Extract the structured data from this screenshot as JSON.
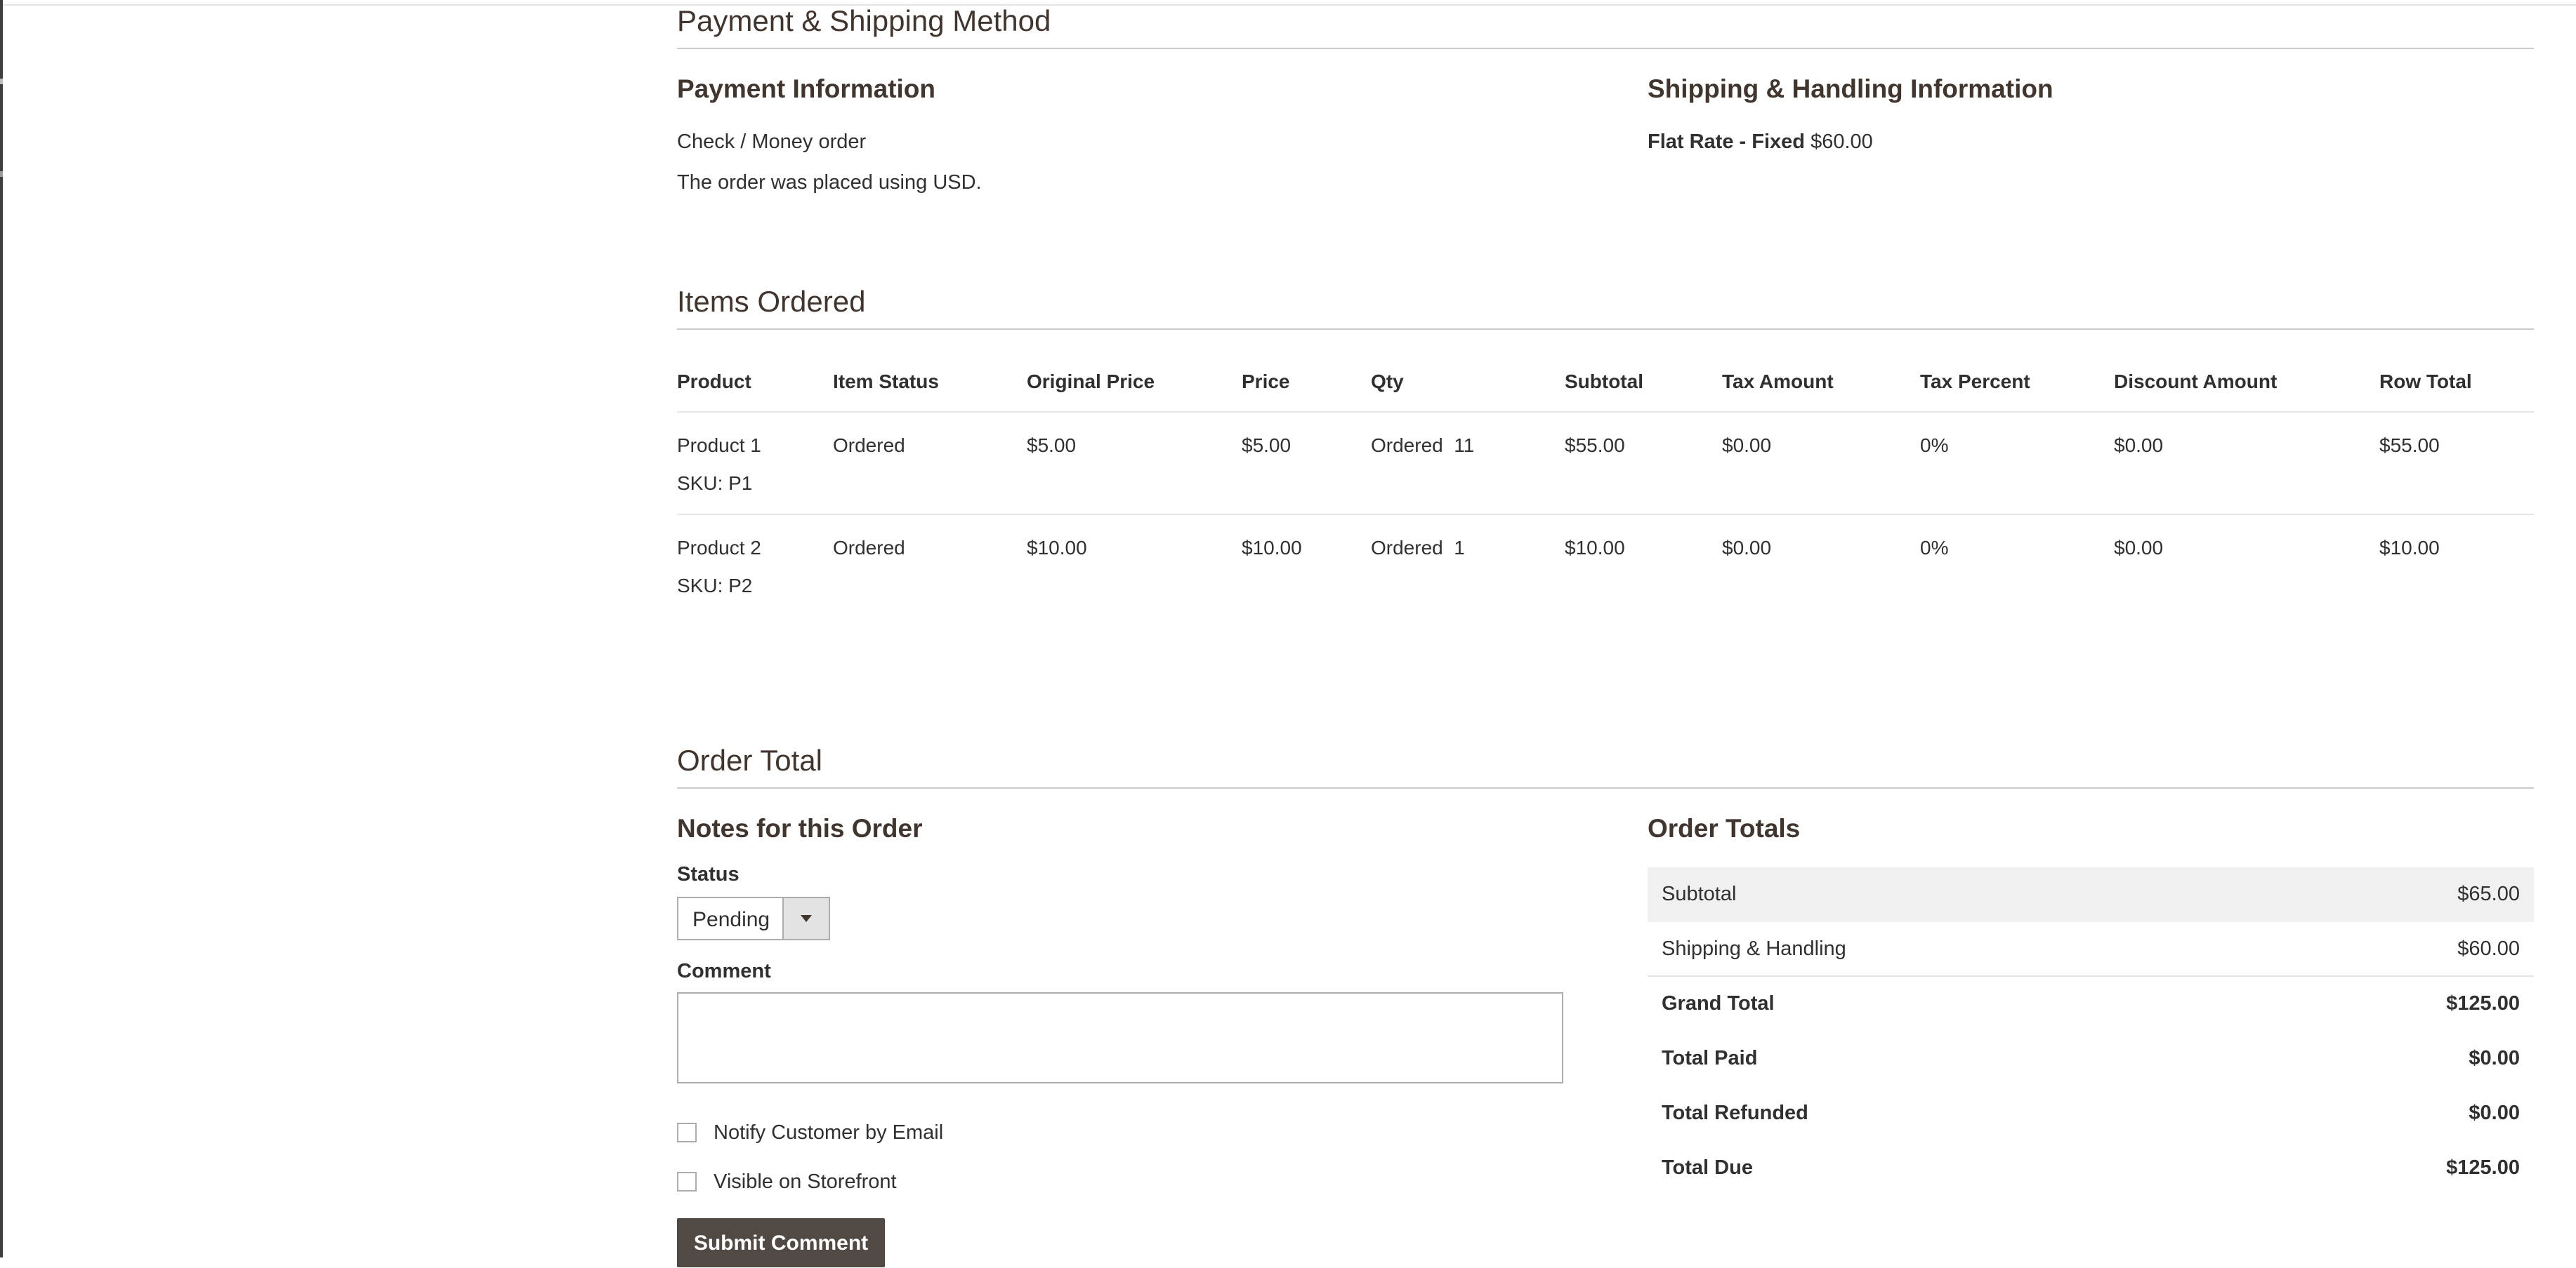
{
  "payment_shipping": {
    "section_title": "Payment & Shipping Method",
    "payment": {
      "title": "Payment Information",
      "method": "Check / Money order",
      "currency_note": "The order was placed using USD."
    },
    "shipping": {
      "title": "Shipping & Handling Information",
      "method_label": "Flat Rate - Fixed",
      "method_price": "$60.00"
    }
  },
  "items_ordered": {
    "section_title": "Items Ordered",
    "columns": [
      "Product",
      "Item Status",
      "Original Price",
      "Price",
      "Qty",
      "Subtotal",
      "Tax Amount",
      "Tax Percent",
      "Discount Amount",
      "Row Total"
    ],
    "rows": [
      {
        "product": "Product 1",
        "sku": "SKU: P1",
        "item_status": "Ordered",
        "original_price": "$5.00",
        "price": "$5.00",
        "qty": "Ordered  11",
        "subtotal": "$55.00",
        "tax_amount": "$0.00",
        "tax_percent": "0%",
        "discount_amount": "$0.00",
        "row_total": "$55.00"
      },
      {
        "product": "Product 2",
        "sku": "SKU: P2",
        "item_status": "Ordered",
        "original_price": "$10.00",
        "price": "$10.00",
        "qty": "Ordered  1",
        "subtotal": "$10.00",
        "tax_amount": "$0.00",
        "tax_percent": "0%",
        "discount_amount": "$0.00",
        "row_total": "$10.00"
      }
    ]
  },
  "order_total": {
    "section_title": "Order Total",
    "notes": {
      "title": "Notes for this Order",
      "status_label": "Status",
      "status_value": "Pending",
      "comment_label": "Comment",
      "comment_value": "",
      "notify_label": "Notify Customer by Email",
      "visible_label": "Visible on Storefront",
      "submit_label": "Submit Comment"
    },
    "totals": {
      "title": "Order Totals",
      "rows": [
        {
          "label": "Subtotal",
          "value": "$65.00"
        },
        {
          "label": "Shipping & Handling",
          "value": "$60.00"
        },
        {
          "label": "Grand Total",
          "value": "$125.00"
        },
        {
          "label": "Total Paid",
          "value": "$0.00"
        },
        {
          "label": "Total Refunded",
          "value": "$0.00"
        },
        {
          "label": "Total Due",
          "value": "$125.00"
        }
      ]
    }
  },
  "icons": {
    "select_arrow": "chevron-down-icon",
    "checkbox": "checkbox-icon"
  },
  "colors": {
    "heading": "#41362f",
    "button_bg": "#514943",
    "shaded_row": "#f0f0f0"
  }
}
